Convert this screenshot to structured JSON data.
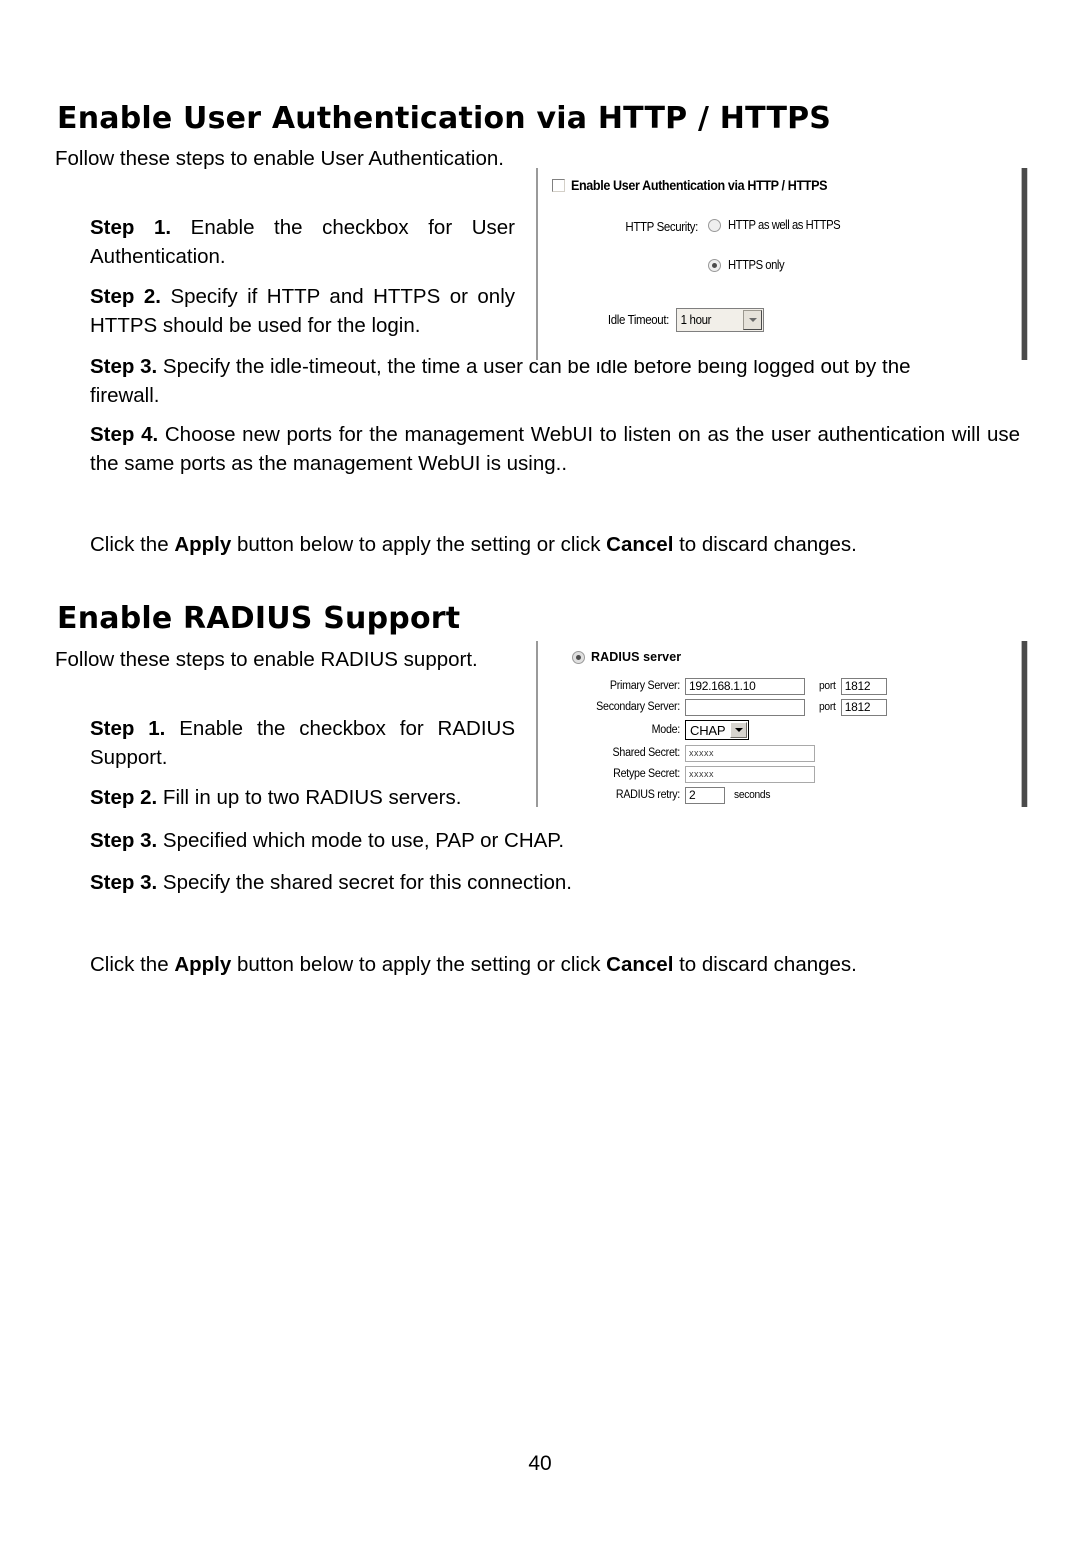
{
  "document": {
    "page_number": "40"
  },
  "sections": [
    {
      "heading": "Enable User Authentication via HTTP / HTTPS",
      "intro": "Follow these steps to enable User Authentication.",
      "steps": [
        {
          "label": "Step 1.",
          "text": "Enable the checkbox for User Authentication."
        },
        {
          "label": "Step 2.",
          "text": "Specify if HTTP and HTTPS or only HTTPS should be used for the login."
        },
        {
          "label": "Step 3.",
          "text": "Specify the idle-timeout, the time a user can be idle before being logged out by the firewall."
        },
        {
          "label": "Step 4.",
          "text": "Choose new ports for the management WebUI to listen on as the user authentication will use the same ports as the management WebUI is using.."
        }
      ],
      "apply_note": {
        "prefix": "Click the ",
        "apply": "Apply",
        "middle": " button below to apply the setting or click ",
        "cancel": "Cancel",
        "suffix": " to discard changes."
      }
    },
    {
      "heading": "Enable RADIUS Support",
      "intro": "Follow these steps to enable RADIUS support.",
      "steps": [
        {
          "label": "Step 1.",
          "text": "Enable the checkbox for RADIUS Support."
        },
        {
          "label": "Step 2.",
          "text": "Fill in up to two RADIUS servers."
        },
        {
          "label": "Step 3.",
          "text": "Specified which mode to use, PAP or CHAP."
        },
        {
          "label": "Step 3.",
          "text": "Specify the shared secret for this connection."
        }
      ],
      "apply_note": {
        "prefix": "Click the ",
        "apply": "Apply",
        "middle": " button below to apply the setting or click ",
        "cancel": "Cancel",
        "suffix": " to discard changes."
      }
    }
  ],
  "http_panel": {
    "enable_checkbox_label": "Enable User Authentication via HTTP / HTTPS",
    "enable_checkbox_checked": false,
    "http_security_label": "HTTP Security:",
    "options": [
      {
        "label": "HTTP as well as HTTPS",
        "selected": false
      },
      {
        "label": "HTTPS only",
        "selected": true
      }
    ],
    "idle_timeout_label": "Idle Timeout:",
    "idle_timeout_value": "1 hour"
  },
  "radius_panel": {
    "title": "RADIUS server",
    "title_selected": true,
    "fields": {
      "primary_server_label": "Primary Server:",
      "primary_server_value": "192.168.1.10",
      "primary_port_label": "port",
      "primary_port_value": "1812",
      "secondary_server_label": "Secondary Server:",
      "secondary_server_value": "",
      "secondary_port_label": "port",
      "secondary_port_value": "1812",
      "mode_label": "Mode:",
      "mode_value": "CHAP",
      "shared_secret_label": "Shared Secret:",
      "shared_secret_value": "xxxxx",
      "retype_secret_label": "Retype Secret:",
      "retype_secret_value": "xxxxx",
      "radius_retry_label": "RADIUS retry:",
      "radius_retry_value": "2",
      "radius_retry_unit": "seconds"
    }
  }
}
